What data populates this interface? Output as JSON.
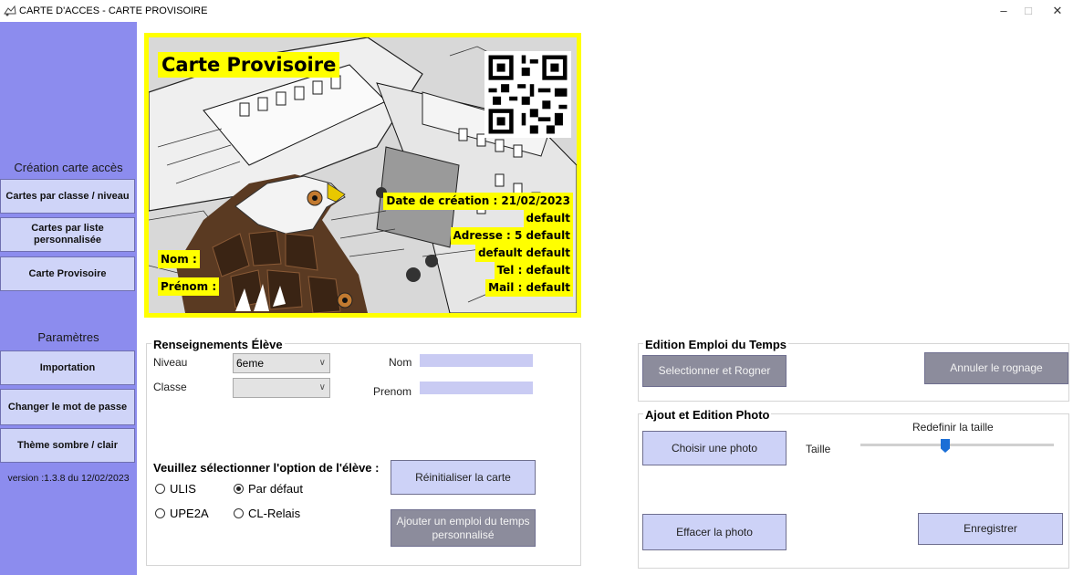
{
  "window": {
    "title": "CARTE D'ACCES - CARTE PROVISOIRE",
    "minimize": "–",
    "maximize": "□",
    "close": "✕"
  },
  "sidebar": {
    "section1": "Création carte accès",
    "btn_classe": "Cartes par classe / niveau",
    "btn_liste": "Cartes par liste personnalisée",
    "btn_provisoire": "Carte Provisoire",
    "section2": "Paramètres",
    "btn_importation": "Importation",
    "btn_motdepasse": "Changer le mot de passe",
    "btn_theme": "Thème sombre / clair",
    "version": "version :1.3.8 du 12/02/2023"
  },
  "card": {
    "title": "Carte Provisoire",
    "date": "Date de création : 21/02/2023",
    "line_default": "default",
    "adresse": "Adresse : 5 default",
    "adresse2": "default default",
    "tel": "Tel : default",
    "mail": "Mail : default",
    "nom_label": "Nom :",
    "prenom_label": "Prénom :"
  },
  "eleve": {
    "title": "Renseignements Élève",
    "niveau_label": "Niveau",
    "niveau_value": "6eme",
    "classe_label": "Classe",
    "classe_value": "",
    "nom_label": "Nom",
    "prenom_label": "Prenom",
    "option_prompt": "Veuillez sélectionner l'option de l'élève :",
    "opt_ulis": "ULIS",
    "opt_defaut": "Par défaut",
    "opt_upe2a": "UPE2A",
    "opt_clrelais": "CL-Relais",
    "btn_reinit": "Réinitialiser la carte",
    "btn_ajouter_edt": "Ajouter un emploi du temps personnalisé"
  },
  "edt": {
    "title": "Edition Emploi du Temps",
    "btn_select": "Selectionner et Rogner",
    "btn_annuler": "Annuler le rognage"
  },
  "photo": {
    "title": "Ajout et Edition Photo",
    "btn_choisir": "Choisir une photo",
    "taille_label": "Taille",
    "redefinir_label": "Redefinir la taille",
    "btn_effacer": "Effacer la photo",
    "btn_enregistrer": "Enregistrer",
    "slider_level": 0.43
  },
  "colors": {
    "sidebar": "#8c8cee",
    "card_frame": "#ffff00",
    "slider_thumb": "#1a6ed6"
  }
}
